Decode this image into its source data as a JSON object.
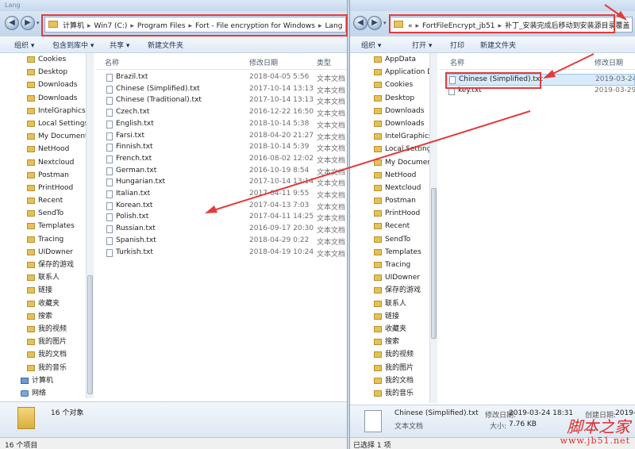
{
  "left": {
    "window_title": "Lang",
    "address_crumbs": [
      "计算机",
      "Win7 (C:)",
      "Program Files",
      "Fort - File encryption for Windows",
      "Lang"
    ],
    "toolbar": [
      "组织 ▾",
      "包含到库中 ▾",
      "共享 ▾",
      "新建文件夹"
    ],
    "tree": [
      "Cookies",
      "Desktop",
      "Downloads",
      "Downloads",
      "IntelGraphicsP",
      "Local Settings",
      "My Document",
      "NetHood",
      "Nextcloud",
      "Postman",
      "PrintHood",
      "Recent",
      "SendTo",
      "Templates",
      "Tracing",
      "UIDowner",
      "保存的游戏",
      "联系人",
      "链接",
      "收藏夹",
      "搜索",
      "我的视频",
      "我的图片",
      "我的文档",
      "我的音乐"
    ],
    "tree_computer": "计算机",
    "tree_network": "网络",
    "columns": {
      "name": "名称",
      "date": "修改日期",
      "type": "类型"
    },
    "files": [
      {
        "name": "Brazil.txt",
        "date": "2018-04-05 5:56",
        "type": "文本文档"
      },
      {
        "name": "Chinese (Simplified).txt",
        "date": "2017-10-14 13:13",
        "type": "文本文档"
      },
      {
        "name": "Chinese (Traditional).txt",
        "date": "2017-10-14 13:13",
        "type": "文本文档"
      },
      {
        "name": "Czech.txt",
        "date": "2016-12-22 16:50",
        "type": "文本文档"
      },
      {
        "name": "English.txt",
        "date": "2018-10-14 5:38",
        "type": "文本文档"
      },
      {
        "name": "Farsi.txt",
        "date": "2018-04-20 21:27",
        "type": "文本文档"
      },
      {
        "name": "Finnish.txt",
        "date": "2018-10-14 5:39",
        "type": "文本文档"
      },
      {
        "name": "French.txt",
        "date": "2016-08-02 12:02",
        "type": "文本文档"
      },
      {
        "name": "German.txt",
        "date": "2016-10-19 8:54",
        "type": "文本文档"
      },
      {
        "name": "Hungarian.txt",
        "date": "2017-10-14 13:14",
        "type": "文本文档"
      },
      {
        "name": "Italian.txt",
        "date": "2017-04-11 9:55",
        "type": "文本文档"
      },
      {
        "name": "Korean.txt",
        "date": "2017-04-13 7:03",
        "type": "文本文档"
      },
      {
        "name": "Polish.txt",
        "date": "2017-04-11 14:25",
        "type": "文本文档"
      },
      {
        "name": "Russian.txt",
        "date": "2016-09-17 20:30",
        "type": "文本文档"
      },
      {
        "name": "Spanish.txt",
        "date": "2018-04-29 0:22",
        "type": "文本文档"
      },
      {
        "name": "Turkish.txt",
        "date": "2018-04-19 10:24",
        "type": "文本文档"
      }
    ],
    "details_text": "16 个对象",
    "status_text": "16 个项目"
  },
  "right": {
    "address_crumbs": [
      "«",
      "FortFileEncrypt_jb51",
      "补丁_安装完成后移动到安装源目录覆盖"
    ],
    "toolbar": [
      "组织 ▾",
      "打开 ▾",
      "打印",
      "新建文件夹"
    ],
    "tree": [
      "AppData",
      "Application Da",
      "Cookies",
      "Desktop",
      "Downloads",
      "Downloads",
      "IntelGraphicsP",
      "Local Settings",
      "My Document",
      "NetHood",
      "Nextcloud",
      "Postman",
      "PrintHood",
      "Recent",
      "SendTo",
      "Templates",
      "Tracing",
      "UIDowner",
      "保存的游戏",
      "联系人",
      "链接",
      "收藏夹",
      "搜索",
      "我的视频",
      "我的图片",
      "我的文档",
      "我的音乐"
    ],
    "columns": {
      "name": "名称",
      "date": "修改日期"
    },
    "files": [
      {
        "name": "Chinese (Simplified).txt",
        "date": "2019-03-24"
      },
      {
        "name": "key.txt",
        "date": "2019-03-29"
      }
    ],
    "details": {
      "name": "Chinese (Simplified).txt",
      "type": "文本文档",
      "modified_label": "修改日期:",
      "modified_value": "2019-03-24 18:31",
      "created_label": "创建日期:",
      "created_value": "2019-0",
      "size_label": "大小:",
      "size_value": "7.76 KB"
    },
    "status_text": "已选择 1 项"
  },
  "watermark": {
    "line1": "脚本之家",
    "line2": "www.jb51.net"
  },
  "colors": {
    "highlight": "#e23b3b",
    "folder": "#e5c158",
    "chrome": "#c3d5ea"
  }
}
